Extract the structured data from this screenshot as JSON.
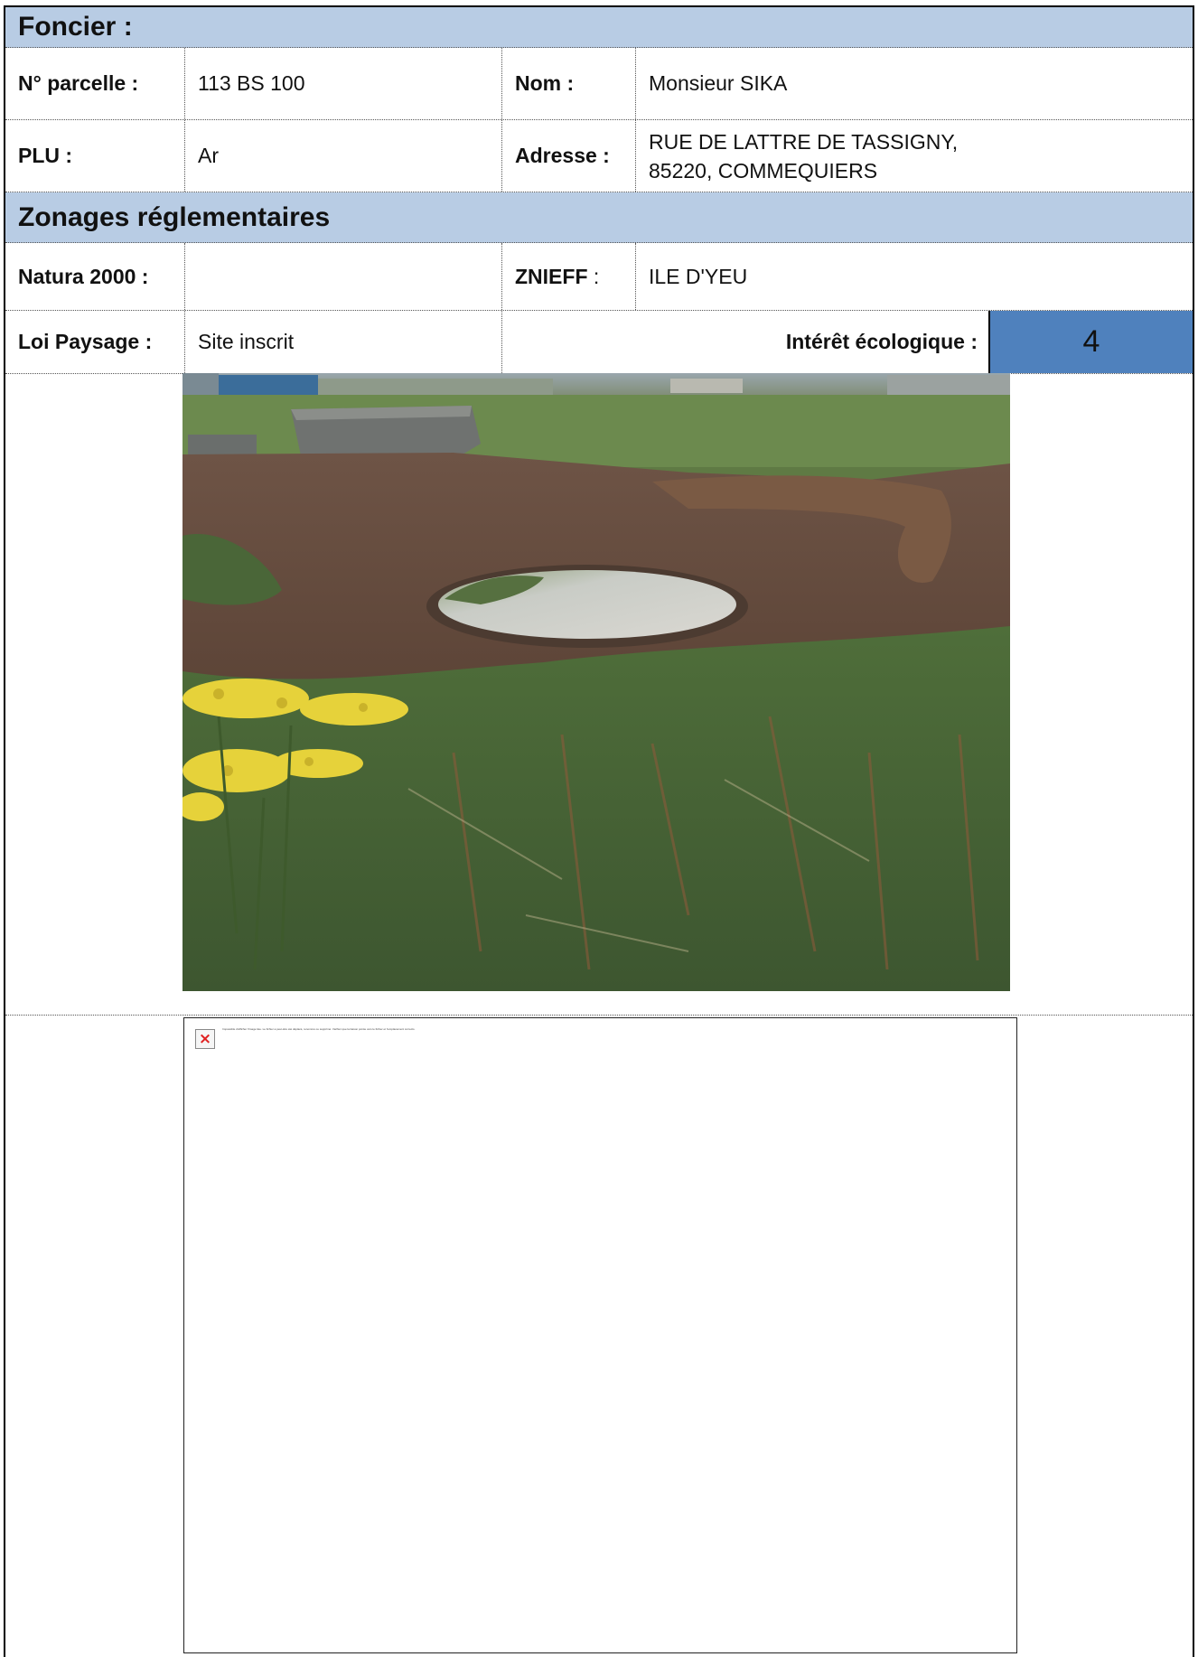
{
  "foncier": {
    "heading": "Foncier :",
    "parcelle_label": "N° parcelle :",
    "parcelle_value": "113 BS 100",
    "nom_label": "Nom :",
    "nom_value": "Monsieur SIKA",
    "plu_label": "PLU :",
    "plu_value": "Ar",
    "adresse_label": "Adresse :",
    "adresse_line1": "RUE DE LATTRE DE TASSIGNY,",
    "adresse_line2": "85220, COMMEQUIERS"
  },
  "zonages": {
    "heading": "Zonages réglementaires",
    "natura_label": "Natura 2000 :",
    "natura_value": "",
    "znieff_label": "ZNIEFF",
    "znieff_colon": " :",
    "znieff_value": "ILE D'YEU",
    "loi_label": "Loi Paysage :",
    "loi_value": "Site inscrit",
    "interet_label": "Intérêt écologique :",
    "interet_value": "4"
  },
  "broken_image": {
    "icon": "broken-image-icon",
    "message": "Impossible d'afficher l'image liée. Le fichier a peut-être été déplacé, renommé ou supprimé. Vérifiez que la liaison pointe vers le fichier et l'emplacement corrects."
  },
  "colors": {
    "band": "#b8cce4",
    "score": "#4f81bd",
    "broken_x": "#e02020"
  }
}
